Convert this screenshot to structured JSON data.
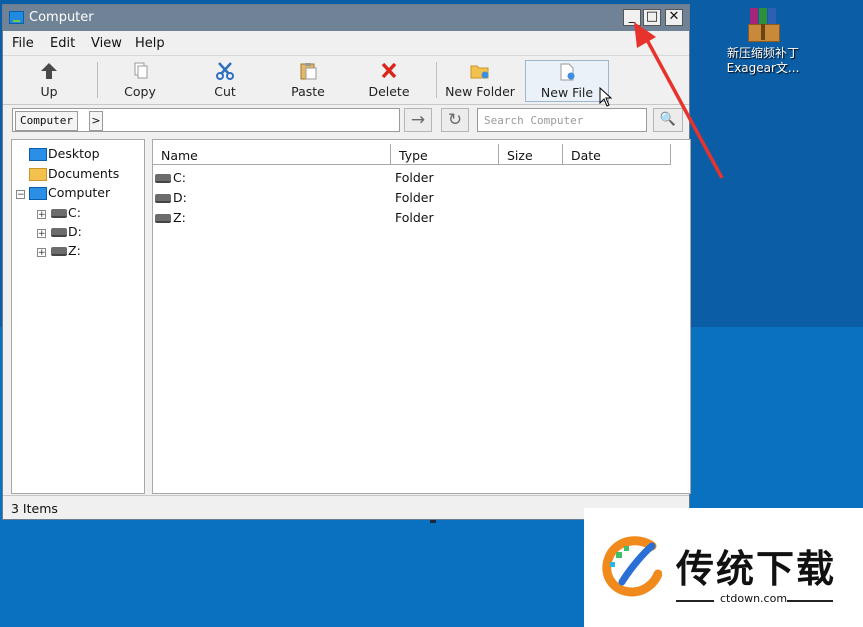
{
  "window": {
    "title": "Computer",
    "controls": {
      "minimize": "_",
      "maximize": "□",
      "close": "✕"
    }
  },
  "menu": [
    "File",
    "Edit",
    "View",
    "Help"
  ],
  "toolbar": {
    "up": "Up",
    "copy": "Copy",
    "cut": "Cut",
    "paste": "Paste",
    "delete": "Delete",
    "new_folder": "New Folder",
    "new_file": "New File"
  },
  "address": {
    "crumb": "Computer",
    "chevron": ">",
    "go": "→",
    "refresh": "↻",
    "search_placeholder": "Search Computer",
    "search_icon": "🔍"
  },
  "tree": {
    "items": [
      {
        "label": "Desktop",
        "icon": "monitor-icon"
      },
      {
        "label": "Documents",
        "icon": "folder-icon"
      },
      {
        "label": "Computer",
        "icon": "monitor-icon",
        "expander": "−"
      },
      {
        "label": "C:",
        "icon": "drive-icon",
        "expander": "+"
      },
      {
        "label": "D:",
        "icon": "drive-icon",
        "expander": "+"
      },
      {
        "label": "Z:",
        "icon": "drive-icon",
        "expander": "+"
      }
    ]
  },
  "list": {
    "columns": [
      "Name",
      "Type",
      "Size",
      "Date"
    ],
    "rows": [
      {
        "name": "C:",
        "type": "Folder"
      },
      {
        "name": "D:",
        "type": "Folder"
      },
      {
        "name": "Z:",
        "type": "Folder"
      }
    ]
  },
  "status": {
    "text": "3 Items"
  },
  "desktop_icon": {
    "label_line1": "新压缩频补丁",
    "label_line2": "Exagear文..."
  },
  "watermark": {
    "title": "传统下载",
    "url": "ctdown.com"
  },
  "colors": {
    "desktop": "#0b5da6",
    "titlebar": "#6f8296",
    "annotation": "#e8332d"
  }
}
